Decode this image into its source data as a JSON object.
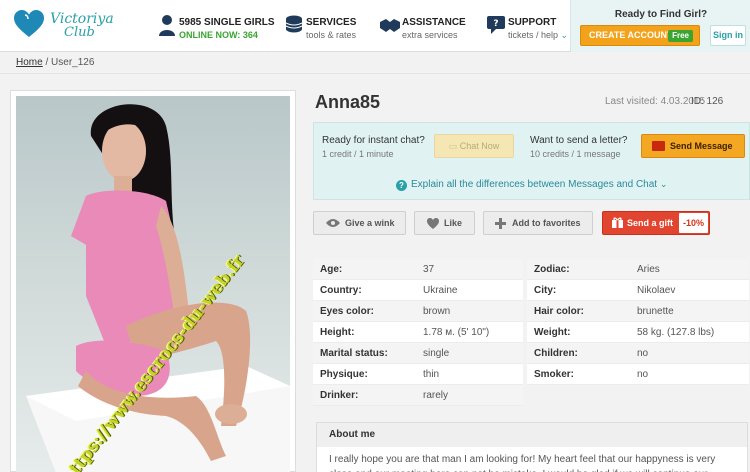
{
  "header": {
    "logo": {
      "line1": "Victoriya",
      "line2": "Club"
    },
    "nav": [
      {
        "title": "5985 SINGLE GIRLS",
        "sub": "ONLINE NOW: 364",
        "icon": "women-icon"
      },
      {
        "title": "SERVICES",
        "sub": "tools & rates",
        "icon": "coins-icon"
      },
      {
        "title": "ASSISTANCE",
        "sub": "extra services",
        "icon": "handshake-icon"
      },
      {
        "title": "SUPPORT",
        "sub": "tickets / help",
        "icon": "chat-icon"
      }
    ],
    "cta": {
      "title": "Ready to Find Girl?",
      "create_label": "CREATE ACCOUNT",
      "free_badge": "Free",
      "signin_label": "Sign in"
    }
  },
  "breadcrumb": {
    "home": "Home",
    "separator": "/",
    "current": "User_126"
  },
  "photo": {
    "watermark": "https://www.escrocs-du-web.fr"
  },
  "profile": {
    "name": "Anna85",
    "last_visited": "Last visited: 4.03.2015",
    "id": "ID: 126",
    "chat": {
      "title": "Ready for instant chat?",
      "cost": "1 credit / 1 minute",
      "button": "Chat Now"
    },
    "letter": {
      "title": "Want to send a letter?",
      "cost": "10 credits / 1 message",
      "button": "Send Message"
    },
    "explain_link": "Explain all the differences between Messages and Chat",
    "actions": {
      "wink": "Give a wink",
      "like": "Like",
      "favorites": "Add to favorites",
      "gift": "Send a gift",
      "gift_discount": "-10%"
    },
    "details": {
      "left": [
        {
          "label": "Age:",
          "value": "37"
        },
        {
          "label": "Country:",
          "value": "Ukraine"
        },
        {
          "label": "Eyes color:",
          "value": "brown"
        },
        {
          "label": "Height:",
          "value": "1.78 м. (5' 10\")"
        },
        {
          "label": "Marital status:",
          "value": "single"
        },
        {
          "label": "Physique:",
          "value": "thin"
        },
        {
          "label": "Drinker:",
          "value": "rarely"
        }
      ],
      "right": [
        {
          "label": "Zodiac:",
          "value": "Aries"
        },
        {
          "label": "City:",
          "value": "Nikolaev"
        },
        {
          "label": "Hair color:",
          "value": "brunette"
        },
        {
          "label": "Weight:",
          "value": "58 kg. (127.8 lbs)"
        },
        {
          "label": "Children:",
          "value": "no"
        },
        {
          "label": "Smoker:",
          "value": "no"
        }
      ]
    },
    "about": {
      "title": "About me",
      "text": "I really hope you are that man I am looking for! My heart feel that our happyness is very close and our meeting here can not be mistake. I would be glad if we will continue our"
    }
  },
  "colors": {
    "accent": "#2aa0a8",
    "orange": "#f4a723",
    "gift_red": "#e2452f",
    "online_green": "#3ba531"
  }
}
